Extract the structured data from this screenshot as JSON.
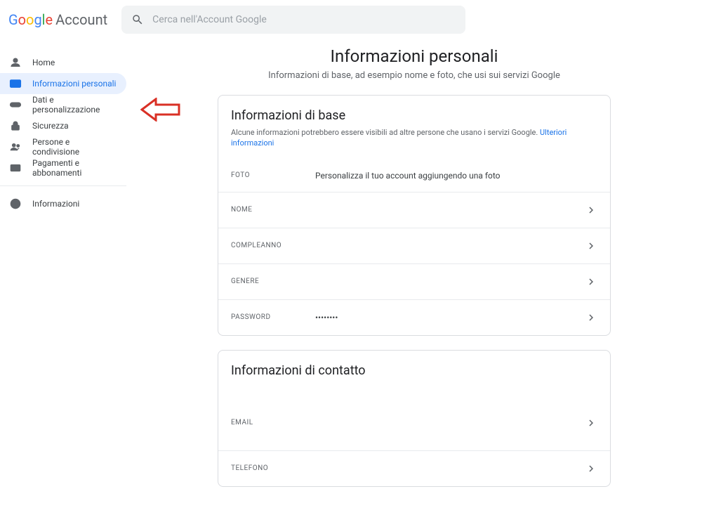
{
  "header": {
    "logo_google": "Google",
    "logo_account": "Account",
    "search_placeholder": "Cerca nell'Account Google"
  },
  "sidebar": {
    "items": [
      {
        "label": "Home",
        "icon": "home-circle-icon",
        "active": false
      },
      {
        "label": "Informazioni personali",
        "icon": "id-card-icon",
        "active": true
      },
      {
        "label": "Dati e personalizzazione",
        "icon": "toggle-icon",
        "active": false
      },
      {
        "label": "Sicurezza",
        "icon": "lock-icon",
        "active": false
      },
      {
        "label": "Persone e condivisione",
        "icon": "people-icon",
        "active": false
      },
      {
        "label": "Pagamenti e abbonamenti",
        "icon": "card-icon",
        "active": false
      }
    ],
    "footer_item": {
      "label": "Informazioni",
      "icon": "info-icon"
    }
  },
  "main": {
    "title": "Informazioni personali",
    "subtitle": "Informazioni di base, ad esempio nome e foto, che usi sui servizi Google"
  },
  "basic_card": {
    "title": "Informazioni di base",
    "description": "Alcune informazioni potrebbero essere visibili ad altre persone che usano i servizi Google. ",
    "more_link": "Ulteriori informazioni",
    "rows": [
      {
        "label": "FOTO",
        "value": "Personalizza il tuo account aggiungendo una foto",
        "chevron": false
      },
      {
        "label": "NOME",
        "value": "",
        "chevron": true
      },
      {
        "label": "COMPLEANNO",
        "value": "",
        "chevron": true
      },
      {
        "label": "GENERE",
        "value": "",
        "chevron": true
      },
      {
        "label": "PASSWORD",
        "value": "••••••••",
        "chevron": true
      }
    ]
  },
  "contact_card": {
    "title": "Informazioni di contatto",
    "rows": [
      {
        "label": "EMAIL",
        "value": "",
        "chevron": true
      },
      {
        "label": "TELEFONO",
        "value": "",
        "chevron": true
      }
    ]
  }
}
